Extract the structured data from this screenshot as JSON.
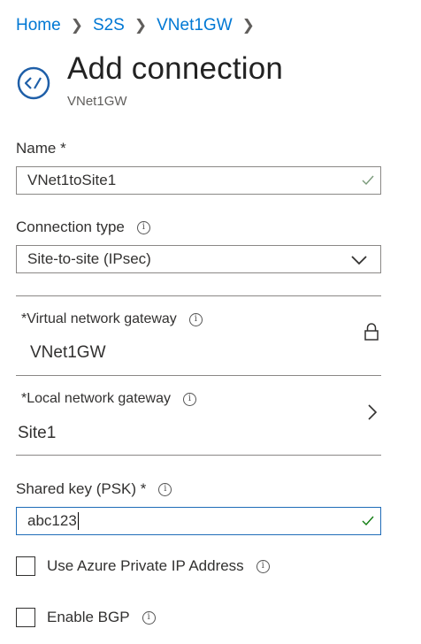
{
  "breadcrumb": {
    "items": [
      "Home",
      "S2S",
      "VNet1GW"
    ]
  },
  "header": {
    "title": "Add connection",
    "subtitle": "VNet1GW"
  },
  "form": {
    "name": {
      "label": "Name *",
      "value": "VNet1toSite1"
    },
    "connection_type": {
      "label": "Connection type",
      "value": "Site-to-site (IPsec)"
    },
    "virtual_network_gateway": {
      "label": "Virtual network gateway",
      "value": "VNet1GW"
    },
    "local_network_gateway": {
      "label": "Local network gateway",
      "value": "Site1"
    },
    "shared_key": {
      "label": "Shared key (PSK) *",
      "value": "abc123"
    },
    "use_private_ip": {
      "label": "Use Azure Private IP Address",
      "checked": false
    },
    "enable_bgp": {
      "label": "Enable BGP",
      "checked": false
    }
  },
  "colors": {
    "accent": "#0078d4",
    "success": "#107c10",
    "border": "#8a8886",
    "text": "#323130"
  },
  "icons": [
    "connection-icon",
    "info-icon",
    "checkmark-icon",
    "chevron-down-icon",
    "lock-icon",
    "chevron-right-icon"
  ]
}
